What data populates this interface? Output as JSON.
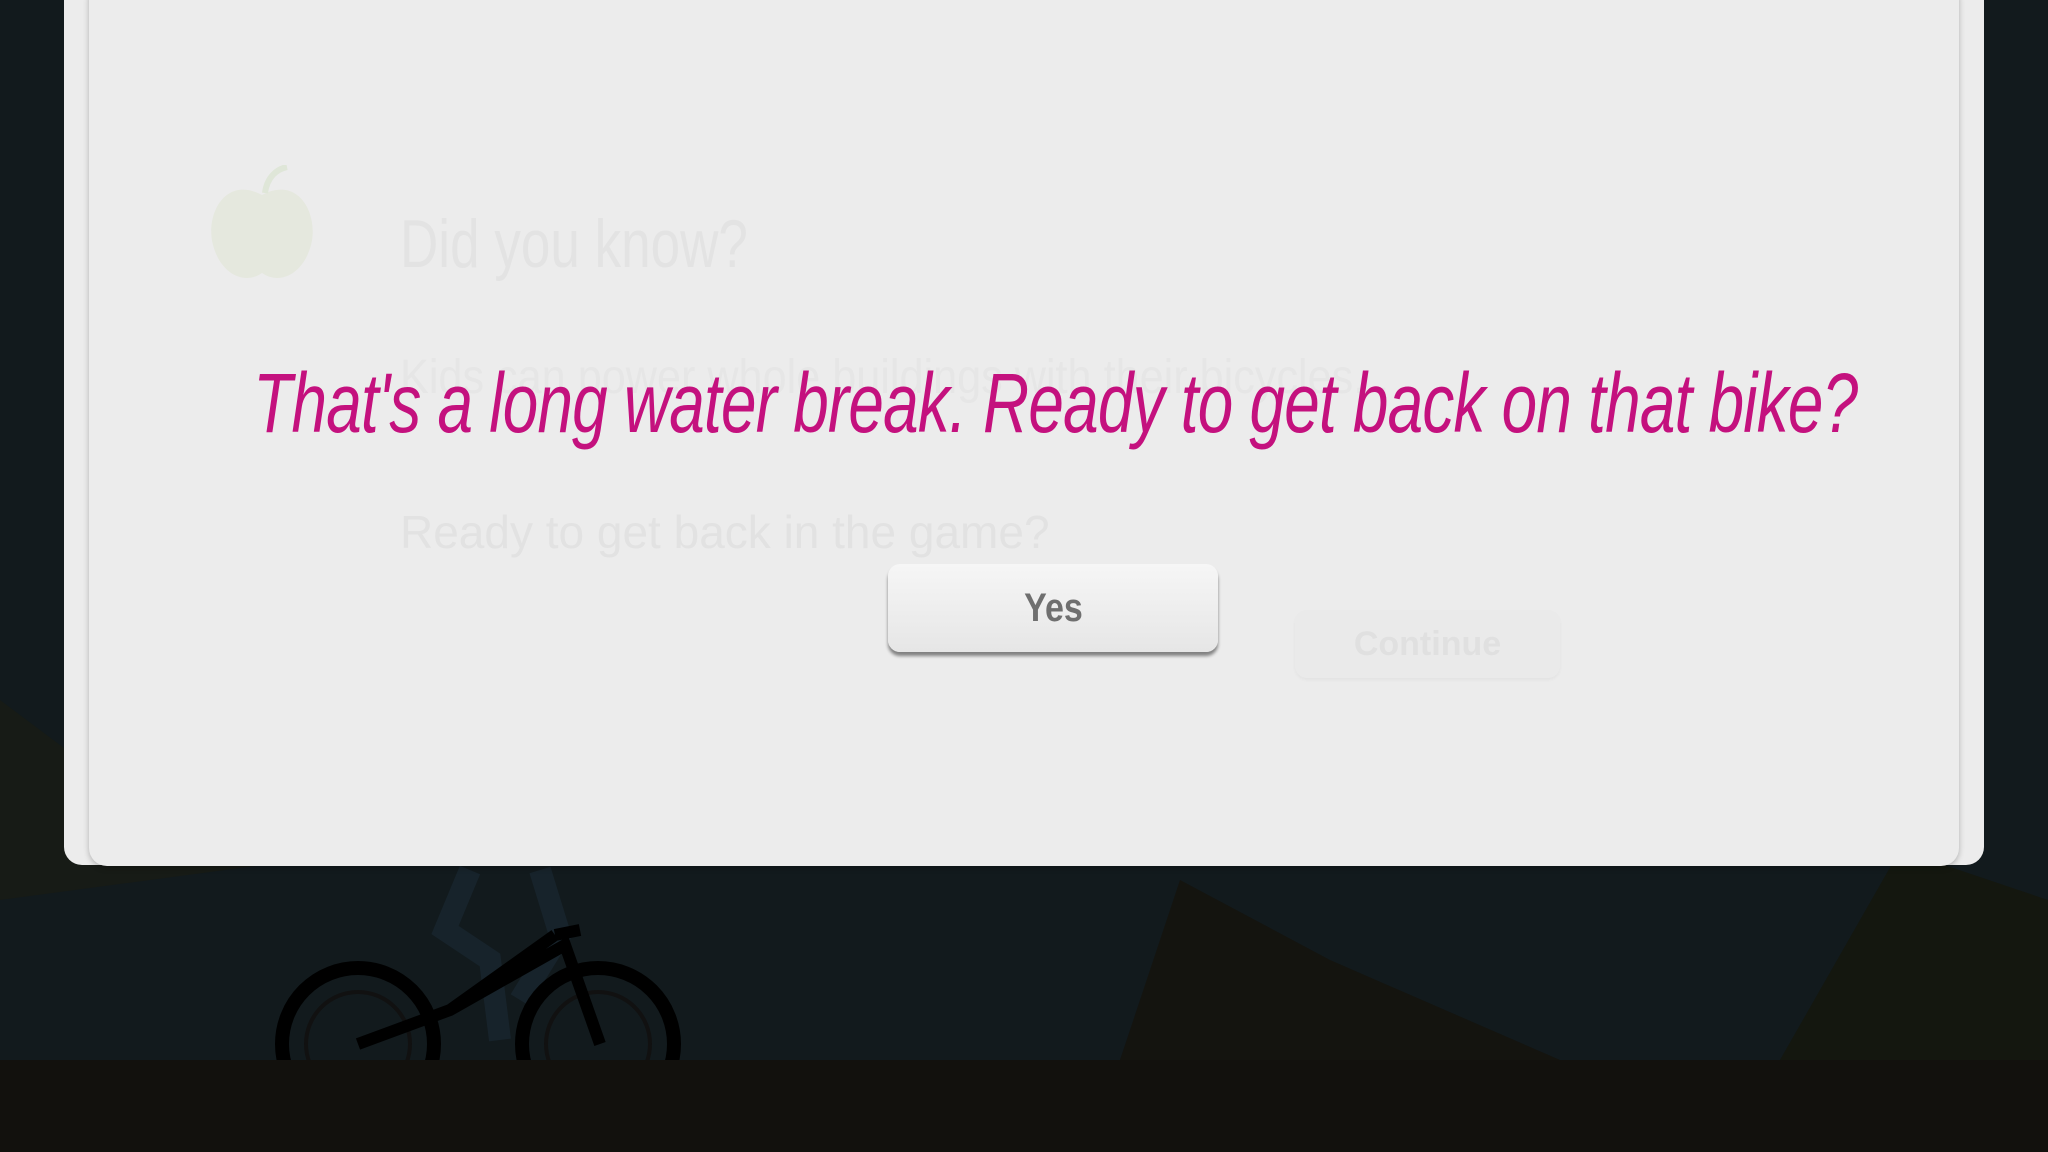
{
  "background_dialog": {
    "title": "Did you know?",
    "body": "Kids can power whole buildings with their bicycles...",
    "prompt": "Ready to get back in the game?",
    "continue_label": "Continue",
    "icon": "apple-icon"
  },
  "alert": {
    "message": "That's a long water break. Ready to get back on that bike?",
    "yes_label": "Yes"
  },
  "colors": {
    "message": "#c4117e",
    "card": "#ececec",
    "background": "#121a1d"
  }
}
